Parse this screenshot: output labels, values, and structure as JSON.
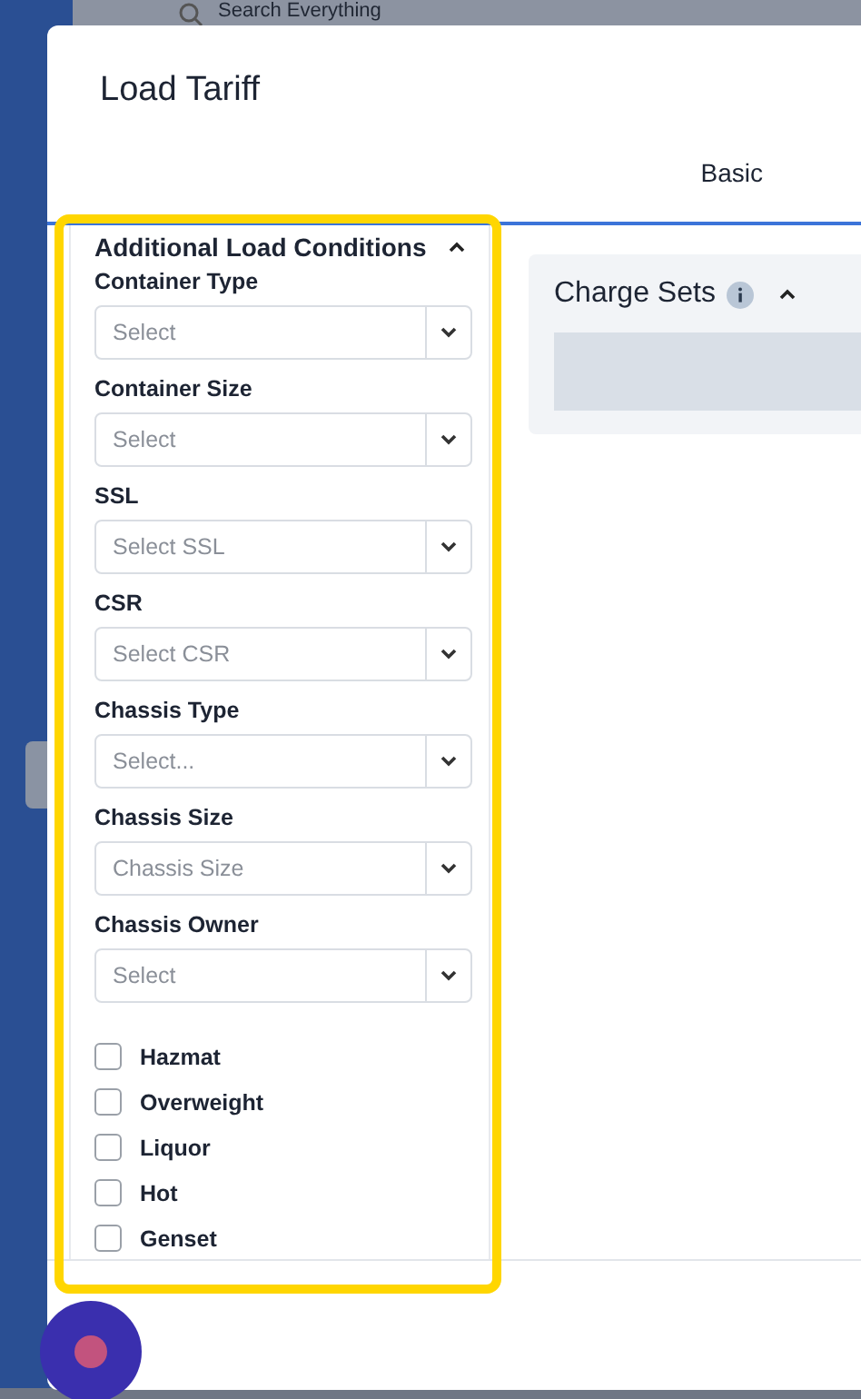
{
  "topbar": {
    "search_placeholder": "Search Everything"
  },
  "modal": {
    "title": "Load Tariff",
    "tabs": [
      {
        "label": "Basic",
        "selected": true
      }
    ],
    "conditions": {
      "title": "Additional Load Conditions",
      "expanded": true,
      "fields": [
        {
          "label": "Container Type",
          "placeholder": "Select"
        },
        {
          "label": "Container Size",
          "placeholder": "Select"
        },
        {
          "label": "SSL",
          "placeholder": "Select SSL"
        },
        {
          "label": "CSR",
          "placeholder": "Select CSR"
        },
        {
          "label": "Chassis Type",
          "placeholder": "Select..."
        },
        {
          "label": "Chassis Size",
          "placeholder": "Chassis Size"
        },
        {
          "label": "Chassis Owner",
          "placeholder": "Select"
        }
      ],
      "checkboxes": [
        {
          "label": "Hazmat",
          "checked": false
        },
        {
          "label": "Overweight",
          "checked": false
        },
        {
          "label": "Liquor",
          "checked": false
        },
        {
          "label": "Hot",
          "checked": false
        },
        {
          "label": "Genset",
          "checked": false
        }
      ]
    },
    "charge_sets": {
      "title": "Charge Sets",
      "expanded": true
    }
  }
}
